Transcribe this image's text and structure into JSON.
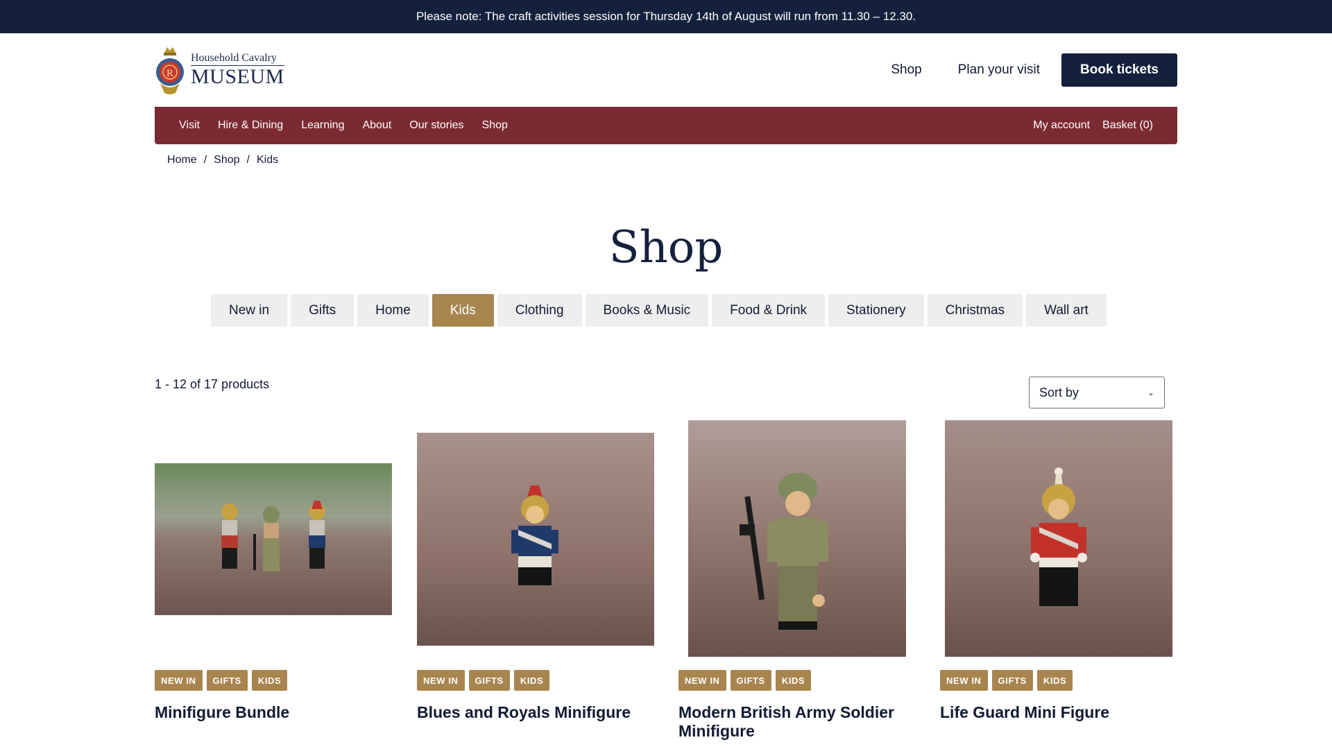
{
  "announcement": "Please note: The craft activities session for Thursday 14th of August will run from 11.30 – 12.30.",
  "logo": {
    "line1": "Household Cavalry",
    "line2": "MUSEUM"
  },
  "utility_nav": {
    "shop": "Shop",
    "plan": "Plan your visit",
    "book": "Book tickets"
  },
  "main_nav": {
    "items": [
      "Visit",
      "Hire & Dining",
      "Learning",
      "About",
      "Our stories",
      "Shop"
    ],
    "account": "My account",
    "basket": "Basket (0)"
  },
  "breadcrumb": [
    "Home",
    "Shop",
    "Kids"
  ],
  "page_title": "Shop",
  "category_tabs": {
    "items": [
      "New in",
      "Gifts",
      "Home",
      "Kids",
      "Clothing",
      "Books & Music",
      "Food & Drink",
      "Stationery",
      "Christmas",
      "Wall art"
    ],
    "active": "Kids"
  },
  "results_count": "1 - 12 of 17 products",
  "sort": {
    "label": "Sort by"
  },
  "products": [
    {
      "title": "Minifigure Bundle",
      "tags": [
        "NEW IN",
        "GIFTS",
        "KIDS"
      ]
    },
    {
      "title": "Blues and Royals Minifigure",
      "tags": [
        "NEW IN",
        "GIFTS",
        "KIDS"
      ]
    },
    {
      "title": "Modern British Army Soldier Minifigure",
      "tags": [
        "NEW IN",
        "GIFTS",
        "KIDS"
      ]
    },
    {
      "title": "Life Guard Mini Figure",
      "tags": [
        "NEW IN",
        "GIFTS",
        "KIDS"
      ]
    }
  ],
  "colors": {
    "navy": "#14213d",
    "burgundy": "#7c2a32",
    "gold": "#a8854f",
    "tab_bg": "#eeeeee"
  }
}
